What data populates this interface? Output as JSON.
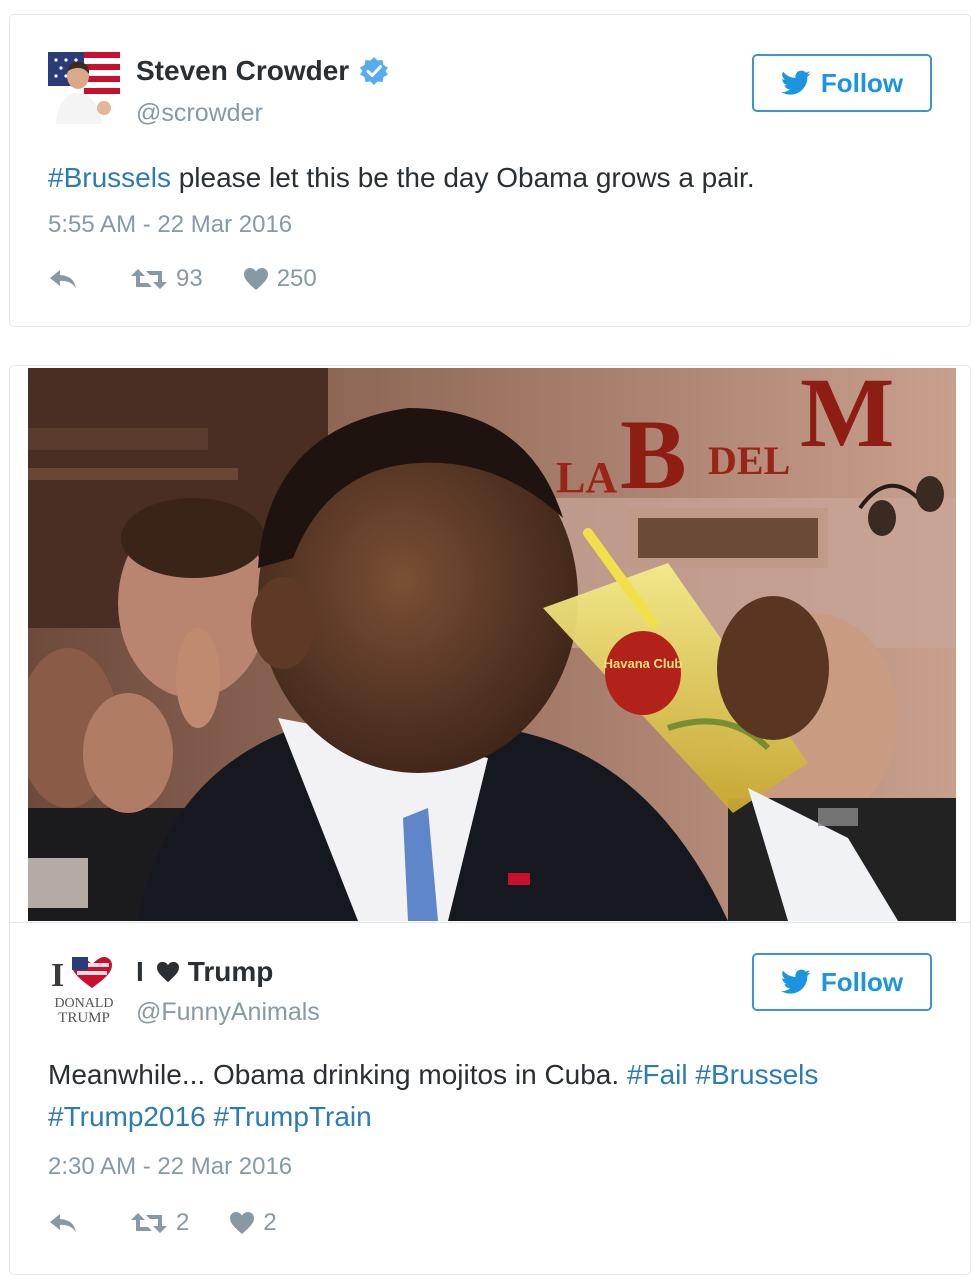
{
  "tweets": [
    {
      "display_name": "Steven Crowder",
      "handle": "@scrowder",
      "verified": true,
      "follow_label": "Follow",
      "text_parts": [
        {
          "text": "#Brussels",
          "hashtag": true
        },
        {
          "text": " please let this be the day Obama grows a pair.",
          "hashtag": false
        }
      ],
      "timestamp": "5:55 AM - 22 Mar 2016",
      "retweets": "93",
      "likes": "250"
    },
    {
      "display_name_prefix": "I",
      "display_name_suffix": "Trump",
      "handle": "@FunnyAnimals",
      "follow_label": "Follow",
      "avatar_text": {
        "top": "I",
        "line1": "DONALD",
        "line2": "TRUMP"
      },
      "photo_sign": {
        "left": "LA",
        "b": "B",
        "del": "DEL",
        "m": "M",
        "glass_label": "Havana Club"
      },
      "text_line1": [
        {
          "text": "Meanwhile... Obama drinking mojitos in Cuba. ",
          "hashtag": false
        },
        {
          "text": "#Fail",
          "hashtag": true
        },
        {
          "text": " ",
          "hashtag": false
        },
        {
          "text": "#Brussels",
          "hashtag": true
        }
      ],
      "text_line2": [
        {
          "text": "#Trump2016",
          "hashtag": true
        },
        {
          "text": " ",
          "hashtag": false
        },
        {
          "text": "#TrumpTrain",
          "hashtag": true
        }
      ],
      "timestamp": "2:30 AM - 22 Mar 2016",
      "retweets": "2",
      "likes": "2"
    }
  ],
  "colors": {
    "link": "#2b7bb9",
    "follow_blue": "#1b95e0",
    "muted": "#8899a6",
    "text": "#292f33",
    "border": "#e1e8ed"
  },
  "icons": [
    "verified-badge-icon",
    "twitter-bird-icon",
    "reply-icon",
    "retweet-icon",
    "heart-icon"
  ]
}
